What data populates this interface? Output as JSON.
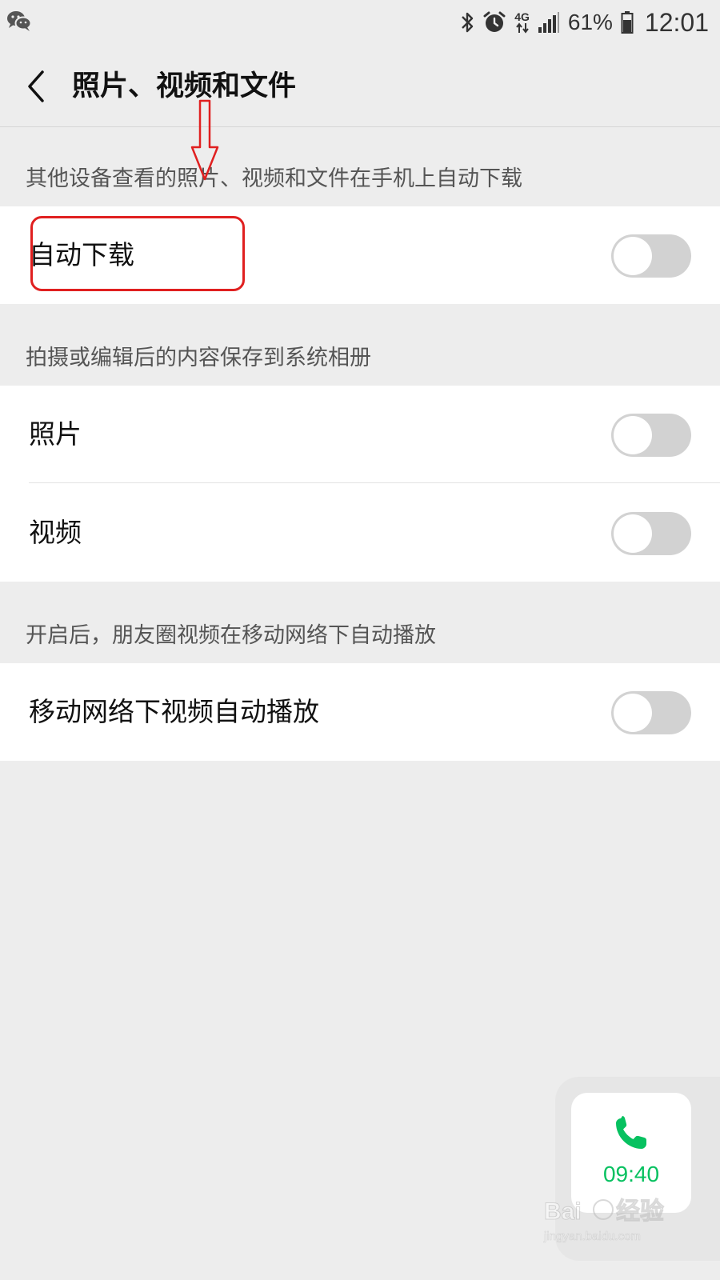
{
  "status_bar": {
    "app_icon": "wechat-icon",
    "icons": [
      "bluetooth-icon",
      "alarm-icon",
      "mobile-data-icon",
      "signal-icon",
      "battery-icon"
    ],
    "network_label": "4G",
    "battery": "61%",
    "time": "12:01"
  },
  "header": {
    "back_icon": "chevron-left-icon",
    "title": "照片、视频和文件"
  },
  "sections": [
    {
      "caption": "其他设备查看的照片、视频和文件在手机上自动下载",
      "rows": [
        {
          "label": "自动下载",
          "enabled": false
        }
      ]
    },
    {
      "caption": "拍摄或编辑后的内容保存到系统相册",
      "rows": [
        {
          "label": "照片",
          "enabled": false
        },
        {
          "label": "视频",
          "enabled": false
        }
      ]
    },
    {
      "caption": "开启后，朋友圈视频在移动网络下自动播放",
      "rows": [
        {
          "label": "移动网络下视频自动播放",
          "enabled": false
        }
      ]
    }
  ],
  "call_widget": {
    "icon": "phone-icon",
    "timer": "09:40"
  },
  "watermark": {
    "brand": "Baidu经验",
    "url": "jingyan.baidu.com"
  },
  "colors": {
    "background": "#ededed",
    "card": "#ffffff",
    "toggle_off": "#d2d2d2",
    "accent_green": "#07c160",
    "annotation_red": "#e02020"
  }
}
